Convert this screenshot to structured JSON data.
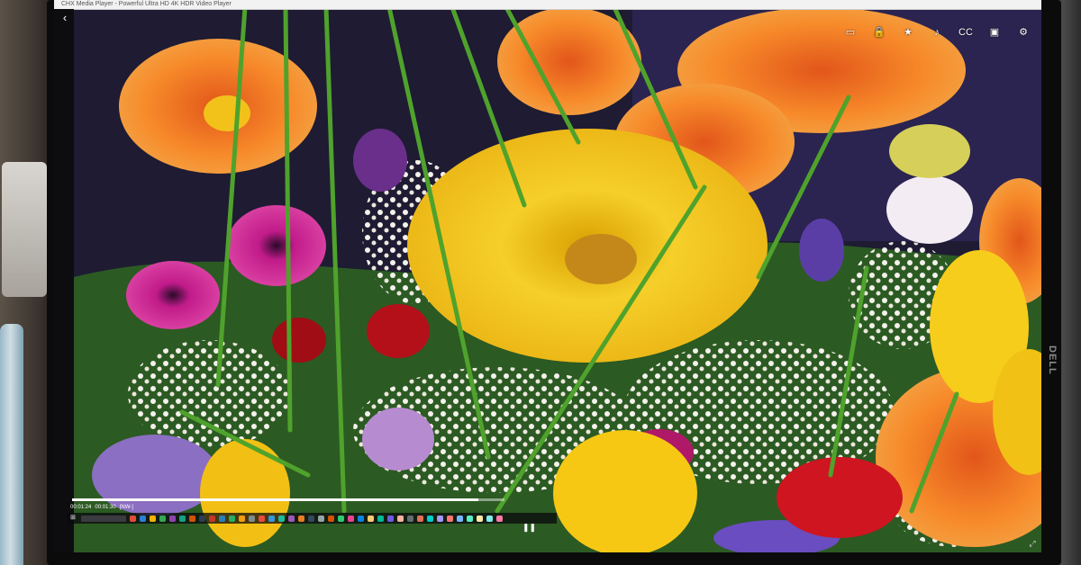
{
  "player": {
    "window_title": "CHX Media Player - Powerful Ultra HD 4K HDR Video Player",
    "current_time": "00:01:24",
    "total_time": "00:01:30",
    "mode_label": "[NW-]",
    "progress": 0.94
  },
  "toolbar": {
    "icons": [
      "screenshot-icon",
      "lock-icon",
      "star-icon",
      "music-icon",
      "subtitle-icon",
      "aspect-icon",
      "settings-icon"
    ],
    "glyphs": [
      "▭",
      "🔒",
      "★",
      "♪",
      "CC",
      "▣",
      "⚙"
    ]
  },
  "controls": {
    "back_glyph": "‹",
    "play_glyph": "❚❚",
    "expand_glyph": "⤢"
  },
  "taskbar": {
    "start_glyph": "⊞",
    "app_colors": [
      "#e44c3a",
      "#2b7fd9",
      "#f4b400",
      "#33a852",
      "#8e44ad",
      "#16a085",
      "#d35400",
      "#2c3e50",
      "#c0392b",
      "#2980b9",
      "#27ae60",
      "#f39c12",
      "#7f8c8d",
      "#e74c3c",
      "#3498db",
      "#1abc9c",
      "#9b59b6",
      "#e67e22",
      "#34495e",
      "#95a5a6",
      "#d35400",
      "#2ecc71",
      "#e84393",
      "#0984e3",
      "#fdcb6e",
      "#00b894",
      "#6c5ce7",
      "#fab1a0",
      "#636e72",
      "#e17055",
      "#00cec9",
      "#a29bfe",
      "#ff7675",
      "#74b9ff",
      "#55efc4",
      "#ffeaa7",
      "#81ecec",
      "#fd79a8"
    ]
  },
  "bezel": {
    "brand": "DELL"
  },
  "colors": {
    "flower_yellow": "#f4c21b",
    "flower_orange": "#f07a1f",
    "flower_magenta": "#b0177a",
    "flower_red": "#d1161c",
    "leaf_green": "#3f8a2a"
  }
}
